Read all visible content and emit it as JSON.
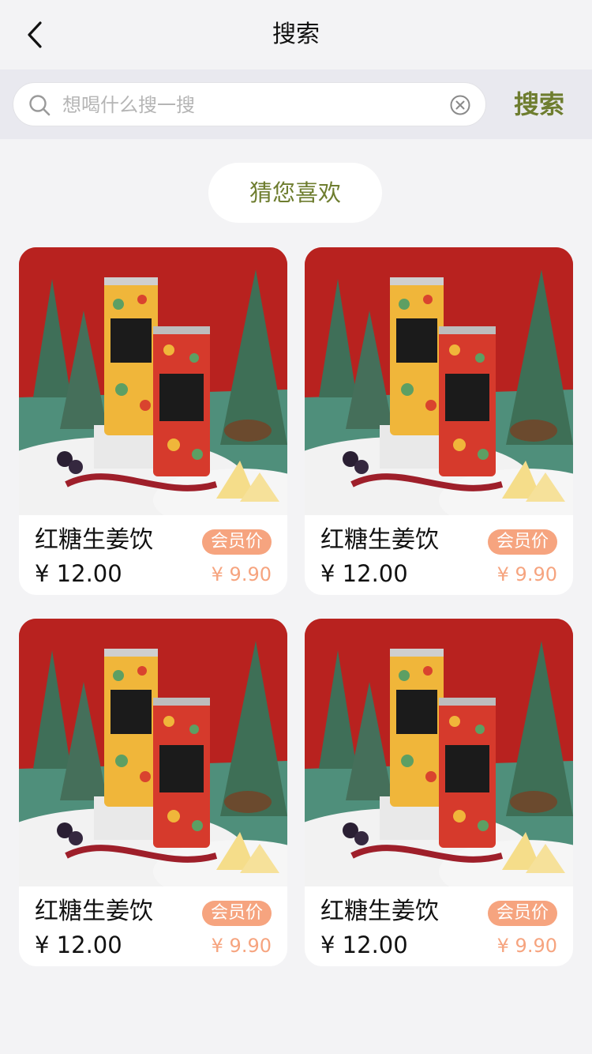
{
  "header": {
    "title": "搜索"
  },
  "search": {
    "placeholder": "想喝什么搜一搜",
    "button_label": "搜索"
  },
  "section": {
    "title": "猜您喜欢"
  },
  "products": [
    {
      "name": "红糖生姜饮",
      "price": "¥ 12.00",
      "member_label": "会员价",
      "member_price": "¥ 9.90"
    },
    {
      "name": "红糖生姜饮",
      "price": "¥ 12.00",
      "member_label": "会员价",
      "member_price": "¥ 9.90"
    },
    {
      "name": "红糖生姜饮",
      "price": "¥ 12.00",
      "member_label": "会员价",
      "member_price": "¥ 9.90"
    },
    {
      "name": "红糖生姜饮",
      "price": "¥ 12.00",
      "member_label": "会员价",
      "member_price": "¥ 9.90"
    }
  ],
  "colors": {
    "accent_green": "#6e7d2f",
    "member_orange": "#f6a47f",
    "page_bg": "#f3f3f5",
    "search_bar_bg": "#e9e9ef"
  },
  "icons": {
    "back": "chevron-left-icon",
    "search": "search-icon",
    "clear": "clear-circle-icon"
  }
}
